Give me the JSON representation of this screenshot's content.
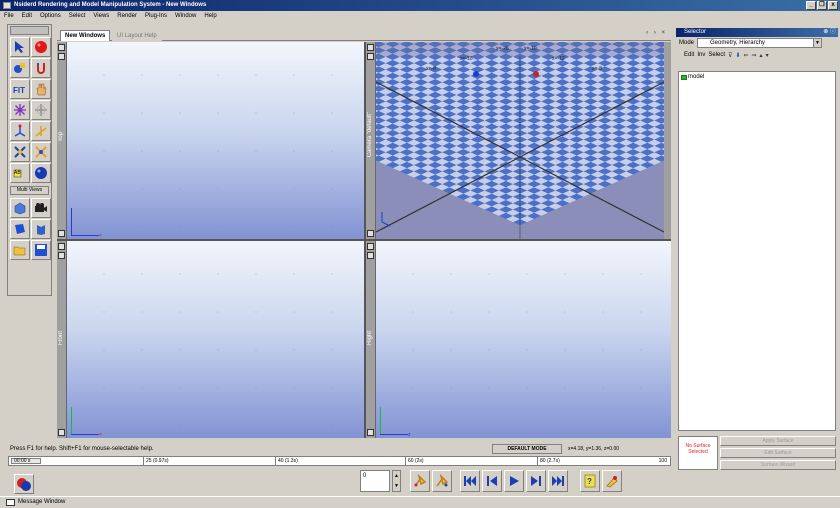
{
  "window": {
    "title": "Nsiderd Rendering and Model Manipulation System - New Windows",
    "controls": [
      "_",
      "❐",
      "x"
    ]
  },
  "menu": [
    "File",
    "Edit",
    "Options",
    "Select",
    "Views",
    "Render",
    "Plug-Ins",
    "Window",
    "Help"
  ],
  "toolbox": {
    "multi_views_label": "Multi Views",
    "tools": [
      "select-arrow-icon",
      "red-sphere-icon",
      "paint-icon",
      "magnet-icon",
      "fit-icon",
      "hand-icon",
      "axis-star-icon",
      "rotate-icon",
      "scale-icon",
      "move-icon",
      "object-icon",
      "cross-icon",
      "light-icon",
      "blue-sphere-icon",
      "cube-icon",
      "camera-icon",
      "flag-icon",
      "book-icon",
      "folder-open-icon",
      "save-icon"
    ]
  },
  "tabs": {
    "active": "New Windows",
    "inactive": "UI Layout Help"
  },
  "viewports": {
    "top": "Top",
    "camera": "Camera \"default\"",
    "front": "Front",
    "right": "Right"
  },
  "perspective": {
    "labels": [
      "x=-16",
      "x=-28",
      "x=-10",
      "x=-8",
      "x=-12",
      "x=-8"
    ]
  },
  "selector": {
    "title": "Selector",
    "mode_label": "Mode",
    "mode_value": "Geometry, Hierarchy",
    "toolbar": [
      "Edit",
      "Inv",
      "Select"
    ],
    "tree_root": "model",
    "no_surface_text": "No Surface Selected",
    "buttons": [
      "Apply Surface",
      "Edit Surface",
      "Surface Wizard"
    ]
  },
  "status": {
    "help_text": "Press F1 for help. Shift+F1 for mouse-selectable help.",
    "mode": "DEFAULT MODE",
    "coords": "x=4.18, y=1.36, z=0.00"
  },
  "timeline": {
    "start": "00:00 s",
    "marks": [
      "25 (0.97s)",
      "40 (1.3s)",
      "60 (2s)",
      "80 (2.7s)"
    ],
    "end": "100"
  },
  "playback": {
    "frame": "0",
    "buttons": [
      "key-set-icon",
      "key-delete-icon",
      "go-to-start-icon",
      "step-back-icon",
      "play-icon",
      "step-forward-icon",
      "go-to-end-icon",
      "record-icon",
      "settings-icon"
    ]
  },
  "message_window": "Message Window",
  "colors": {
    "titlebar_start": "#0a246a",
    "titlebar_end": "#3a6ea5",
    "viewport_top": "#f2f6fc",
    "viewport_bottom": "#8293d4",
    "checker_a": "#4b70c8",
    "checker_b": "#c8cee6"
  }
}
